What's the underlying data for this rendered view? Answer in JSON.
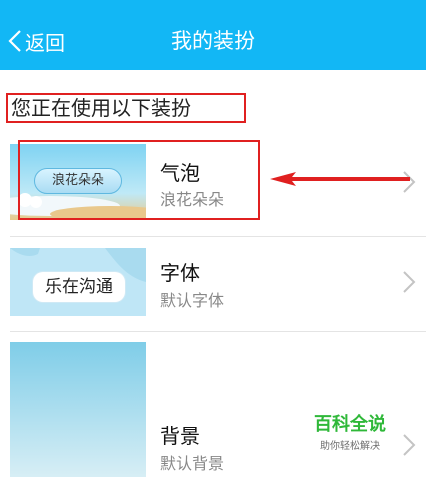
{
  "header": {
    "back_label": "返回",
    "title": "我的装扮",
    "background": "#12b7f5"
  },
  "section": {
    "title": "您正在使用以下装扮"
  },
  "items": [
    {
      "name": "气泡",
      "value": "浪花朵朵",
      "preview_text": "浪花朵朵"
    },
    {
      "name": "字体",
      "value": "默认字体",
      "preview_text": "乐在沟通"
    },
    {
      "name": "背景",
      "value": "默认背景"
    }
  ],
  "watermark": {
    "title": "百科全说",
    "subtitle": "助你轻松解决"
  },
  "colors": {
    "annotation_red": "#e02020",
    "watermark_green": "#2fb839"
  }
}
